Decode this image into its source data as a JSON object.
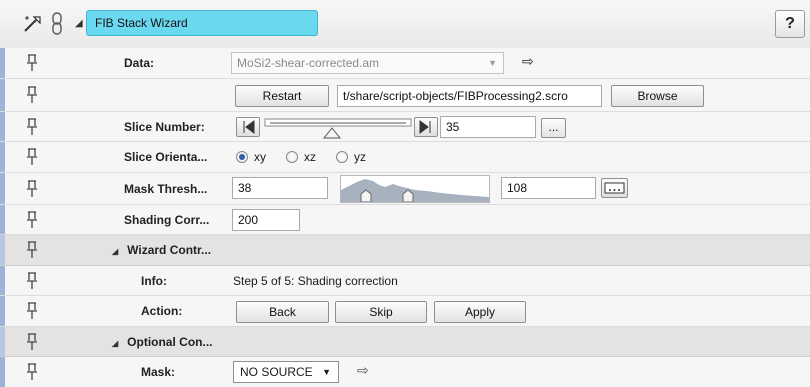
{
  "header": {
    "title": "FIB Stack Wizard",
    "help_label": "?",
    "icons": [
      "wand-icon",
      "chain-link-icon",
      "collapse-triangle-icon"
    ]
  },
  "data_row": {
    "label": "Data:",
    "value": "MoSi2-shear-corrected.am"
  },
  "script_row": {
    "restart_label": "Restart",
    "path": "t/share/script-objects/FIBProcessing2.scro",
    "browse_label": "Browse"
  },
  "slice_number": {
    "label": "Slice Number:",
    "value": "35",
    "more_label": "..."
  },
  "slice_orientation": {
    "label": "Slice Orienta...",
    "options": [
      "xy",
      "xz",
      "yz"
    ],
    "selected": "xy"
  },
  "mask_threshold": {
    "label": "Mask Thresh...",
    "min": "38",
    "max": "108"
  },
  "shading": {
    "label": "Shading Corr...",
    "value": "200"
  },
  "wizard_group": {
    "label": "Wizard Contr...",
    "info_label": "Info:",
    "info_value": "Step 5 of 5: Shading correction",
    "action_label": "Action:",
    "back_label": "Back",
    "skip_label": "Skip",
    "apply_label": "Apply"
  },
  "optional_group": {
    "label": "Optional Con...",
    "mask_label": "Mask:",
    "mask_value": "NO SOURCE"
  },
  "colors": {
    "title_bg": "#6ad9f0",
    "row_bar": "#9fb3d8",
    "group_bg": "#e3e3e3"
  }
}
